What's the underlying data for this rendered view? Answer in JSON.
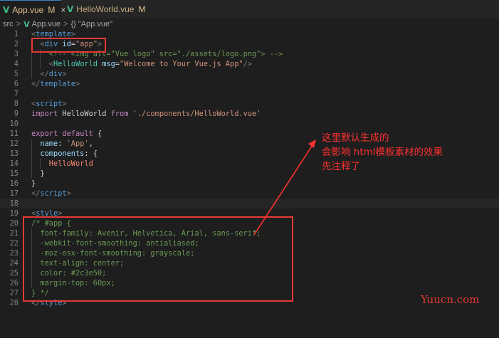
{
  "tabs": [
    {
      "name": "App.vue",
      "badge": "M",
      "close": "×",
      "icon": "V"
    },
    {
      "name": "HelloWorld.vue",
      "badge": "M",
      "icon": "V"
    }
  ],
  "breadcrumb": {
    "folder": "src",
    "sep": ">",
    "file": "App.vue",
    "symbol_icon": "{}",
    "symbol": "\"App.vue\""
  },
  "lines": [
    {
      "n": "1",
      "indent": 0,
      "segs": [
        [
          "t-punc",
          "<"
        ],
        [
          "t-tag",
          "template"
        ],
        [
          "t-punc",
          ">"
        ]
      ]
    },
    {
      "n": "2",
      "indent": 1,
      "segs": [
        [
          "t-punc",
          "<"
        ],
        [
          "t-tag",
          "div"
        ],
        [
          "t-txt",
          " "
        ],
        [
          "t-attr",
          "id"
        ],
        [
          "t-txt",
          "="
        ],
        [
          "t-str",
          "\"app\""
        ],
        [
          "t-punc",
          ">"
        ]
      ]
    },
    {
      "n": "3",
      "indent": 2,
      "segs": [
        [
          "t-com",
          "<!-- <img alt=\"Vue logo\" src=\"./assets/logo.png\"> -->"
        ]
      ]
    },
    {
      "n": "4",
      "indent": 2,
      "segs": [
        [
          "t-punc",
          "<"
        ],
        [
          "t-comp",
          "HelloWorld"
        ],
        [
          "t-txt",
          " "
        ],
        [
          "t-attr",
          "msg"
        ],
        [
          "t-txt",
          "="
        ],
        [
          "t-str",
          "\"Welcome to Your Vue.js App\""
        ],
        [
          "t-punc",
          "/>"
        ]
      ]
    },
    {
      "n": "5",
      "indent": 1,
      "segs": [
        [
          "t-punc",
          "</"
        ],
        [
          "t-tag",
          "div"
        ],
        [
          "t-punc",
          ">"
        ]
      ]
    },
    {
      "n": "6",
      "indent": 0,
      "segs": [
        [
          "t-punc",
          "</"
        ],
        [
          "t-tag",
          "template"
        ],
        [
          "t-punc",
          ">"
        ]
      ]
    },
    {
      "n": "7",
      "indent": 0,
      "segs": []
    },
    {
      "n": "8",
      "indent": 0,
      "segs": [
        [
          "t-punc",
          "<"
        ],
        [
          "t-tag",
          "script"
        ],
        [
          "t-punc",
          ">"
        ]
      ]
    },
    {
      "n": "9",
      "indent": 0,
      "segs": [
        [
          "t-kw",
          "import"
        ],
        [
          "t-txt",
          " HelloWorld "
        ],
        [
          "t-kw",
          "from"
        ],
        [
          "t-txt",
          " "
        ],
        [
          "t-str",
          "'./components/HelloWorld.vue'"
        ]
      ]
    },
    {
      "n": "10",
      "indent": 0,
      "segs": []
    },
    {
      "n": "11",
      "indent": 0,
      "segs": [
        [
          "t-kw",
          "export"
        ],
        [
          "t-txt",
          " "
        ],
        [
          "t-kw",
          "default"
        ],
        [
          "t-txt",
          " {"
        ]
      ]
    },
    {
      "n": "12",
      "indent": 1,
      "segs": [
        [
          "t-attr",
          "name"
        ],
        [
          "t-txt",
          ": "
        ],
        [
          "t-str",
          "'App'"
        ],
        [
          "t-txt",
          ","
        ]
      ]
    },
    {
      "n": "13",
      "indent": 1,
      "segs": [
        [
          "t-attr",
          "components"
        ],
        [
          "t-txt",
          ": {"
        ]
      ]
    },
    {
      "n": "14",
      "indent": 2,
      "segs": [
        [
          "t-err",
          "HelloWorld"
        ]
      ]
    },
    {
      "n": "15",
      "indent": 1,
      "segs": [
        [
          "t-txt",
          "}"
        ]
      ]
    },
    {
      "n": "16",
      "indent": 0,
      "segs": [
        [
          "t-txt",
          "}"
        ]
      ]
    },
    {
      "n": "17",
      "indent": 0,
      "segs": [
        [
          "t-punc",
          "</"
        ],
        [
          "t-tag",
          "script"
        ],
        [
          "t-punc",
          ">"
        ]
      ]
    },
    {
      "n": "18",
      "indent": 0,
      "segs": []
    },
    {
      "n": "19",
      "indent": 0,
      "segs": [
        [
          "t-punc",
          "<"
        ],
        [
          "t-tag",
          "style"
        ],
        [
          "t-punc",
          ">"
        ]
      ]
    },
    {
      "n": "20",
      "indent": 0,
      "segs": [
        [
          "t-com",
          "/* #app {"
        ]
      ]
    },
    {
      "n": "21",
      "indent": 1,
      "segs": [
        [
          "t-com",
          "font-family: Avenir, Helvetica, Arial, sans-serif;"
        ]
      ]
    },
    {
      "n": "22",
      "indent": 1,
      "segs": [
        [
          "t-com",
          "-webkit-font-smoothing: antialiased;"
        ]
      ]
    },
    {
      "n": "23",
      "indent": 1,
      "segs": [
        [
          "t-com",
          "-moz-osx-font-smoothing: grayscale;"
        ]
      ]
    },
    {
      "n": "24",
      "indent": 1,
      "segs": [
        [
          "t-com",
          "text-align: center;"
        ]
      ]
    },
    {
      "n": "25",
      "indent": 1,
      "segs": [
        [
          "t-com",
          "color: #2c3e50;"
        ]
      ]
    },
    {
      "n": "26",
      "indent": 1,
      "segs": [
        [
          "t-com",
          "margin-top: 60px;"
        ]
      ]
    },
    {
      "n": "27",
      "indent": 0,
      "segs": [
        [
          "t-com",
          "} */"
        ]
      ]
    },
    {
      "n": "28",
      "indent": 0,
      "segs": [
        [
          "t-punc",
          "</"
        ],
        [
          "t-tag",
          "style"
        ],
        [
          "t-punc",
          ">"
        ]
      ]
    }
  ],
  "annotation": {
    "line1": "这里默认生成的",
    "line2": "会影响 html模板素材的效果",
    "line3": "先注释了",
    "color": "#ff3030"
  },
  "watermark": "Yuucn.com",
  "colors": {
    "accent": "#3c82c4",
    "vue_green": "#41b883",
    "modified": "#e2c08d",
    "highlight_box": "#e53935"
  }
}
